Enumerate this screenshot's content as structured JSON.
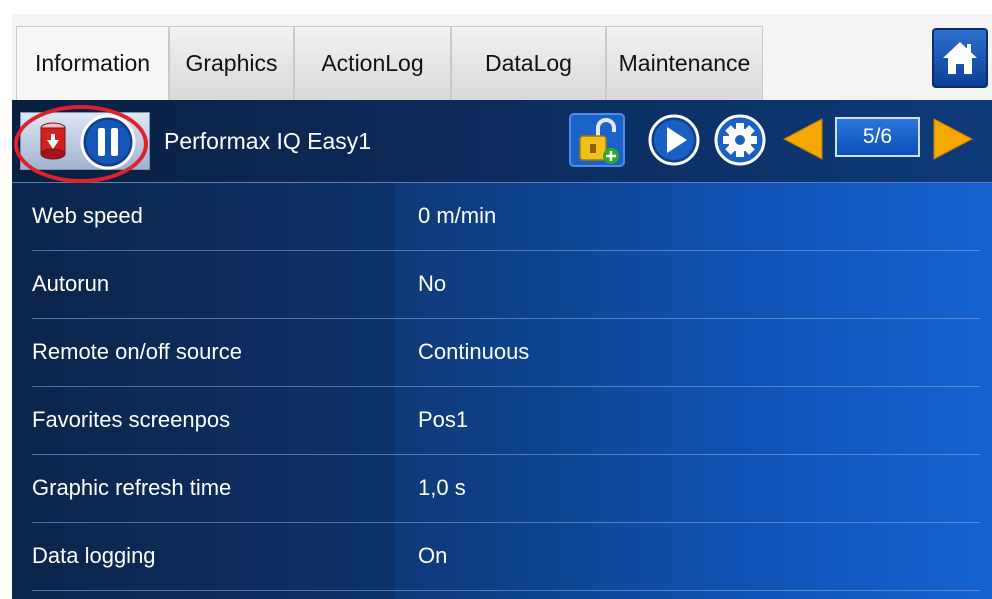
{
  "tabs": [
    {
      "label": "Information",
      "active": true
    },
    {
      "label": "Graphics",
      "active": false
    },
    {
      "label": "ActionLog",
      "active": false
    },
    {
      "label": "DataLog",
      "active": false
    },
    {
      "label": "Maintenance",
      "active": false
    }
  ],
  "toolbar": {
    "device_name": "Performax IQ Easy1",
    "page_indicator": "5/6",
    "icons": [
      "device-status-icon",
      "pause-icon",
      "unlock-icon",
      "play-icon",
      "gear-icon",
      "previous-page-icon",
      "next-page-icon",
      "home-icon"
    ]
  },
  "rows": [
    {
      "label": "Web speed",
      "value": "0 m/min"
    },
    {
      "label": "Autorun",
      "value": "No"
    },
    {
      "label": "Remote on/off source",
      "value": "Continuous"
    },
    {
      "label": "Favorites screenpos",
      "value": "Pos1"
    },
    {
      "label": "Graphic refresh time",
      "value": "1,0 s"
    },
    {
      "label": "Data logging",
      "value": "On"
    }
  ],
  "colors": {
    "highlight_circle": "#e0202a",
    "accent_arrow": "#f5a800",
    "panel_blue": "#0f52b5"
  }
}
